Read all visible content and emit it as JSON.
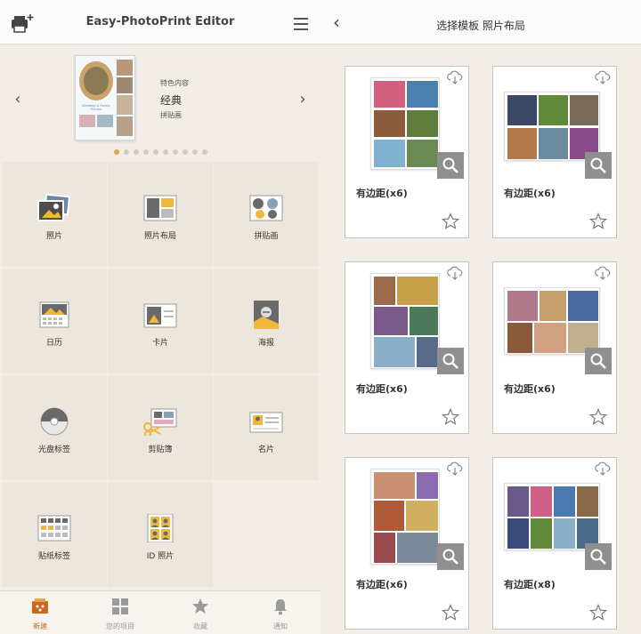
{
  "left": {
    "app_title": "Easy-PhotoPrint Editor",
    "hero": {
      "featured_label": "特色内容",
      "title": "经典",
      "subtitle": "拼贴画",
      "thumb_text": "Wedding & Family Photos",
      "dots_total": 10,
      "dots_active": 0
    },
    "tiles": [
      {
        "label": "照片",
        "icon": "photo-icon"
      },
      {
        "label": "照片布局",
        "icon": "photo-layout-icon"
      },
      {
        "label": "拼贴画",
        "icon": "collage-icon"
      },
      {
        "label": "日历",
        "icon": "calendar-icon"
      },
      {
        "label": "卡片",
        "icon": "card-icon"
      },
      {
        "label": "海报",
        "icon": "poster-icon"
      },
      {
        "label": "光盘标签",
        "icon": "disc-label-icon"
      },
      {
        "label": "剪贴簿",
        "icon": "scrapbook-icon"
      },
      {
        "label": "名片",
        "icon": "business-card-icon"
      },
      {
        "label": "贴纸标签",
        "icon": "sticker-label-icon"
      },
      {
        "label": "ID 照片",
        "icon": "id-photo-icon"
      }
    ],
    "tabs": [
      {
        "label": "新建",
        "icon": "new-icon",
        "active": true
      },
      {
        "label": "您的项目",
        "icon": "grid-icon",
        "active": false
      },
      {
        "label": "收藏",
        "icon": "star-icon",
        "active": false
      },
      {
        "label": "通知",
        "icon": "bell-icon",
        "active": false
      }
    ]
  },
  "right": {
    "title": "选择模板 照片布局",
    "templates": [
      {
        "label": "有边距(x6)"
      },
      {
        "label": "有边距(x6)"
      },
      {
        "label": "有边距(x6)"
      },
      {
        "label": "有边距(x6)"
      },
      {
        "label": "有边距(x6)"
      },
      {
        "label": "有边距(x8)"
      }
    ]
  },
  "colors": {
    "background": "#f2eee7",
    "tile": "#ece6dc",
    "accent": "#e8a24a",
    "active_tab": "#c9691f",
    "zoom_button": "#8f8f8f"
  }
}
